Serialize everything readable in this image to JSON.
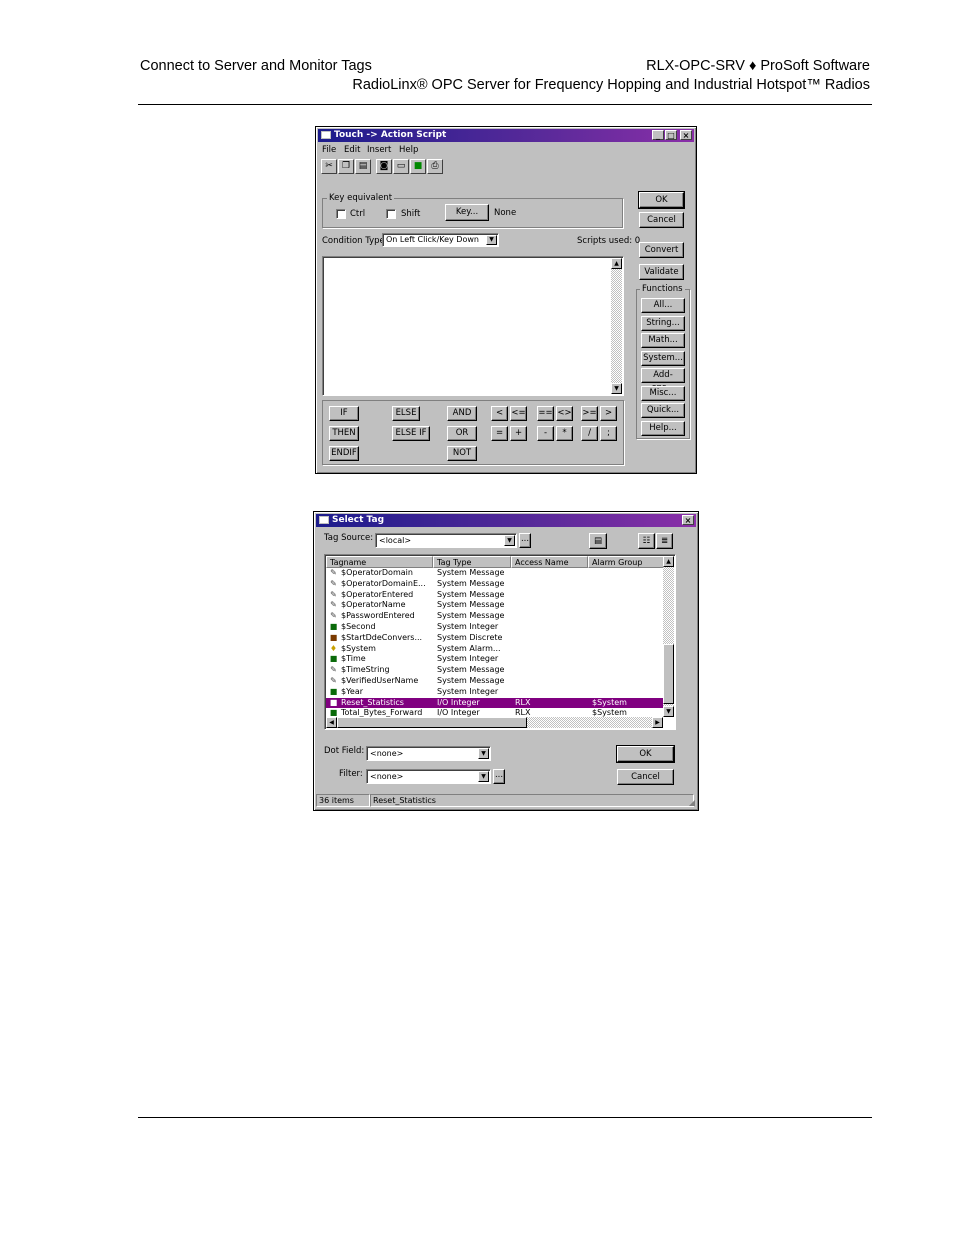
{
  "header": {
    "left": "Connect to Server and Monitor Tags",
    "right_line1": "RLX-OPC-SRV ♦ ProSoft Software",
    "right_line2": "RadioLinx® OPC Server for Frequency Hopping and Industrial Hotspot™ Radios"
  },
  "action_script": {
    "title": "Touch -> Action Script",
    "menu": [
      "File",
      "Edit",
      "Insert",
      "Help"
    ],
    "toolbar_icons": [
      "cut-icon",
      "copy-icon",
      "paste-icon",
      "find-icon",
      "window-icon",
      "import-icon",
      "print-icon"
    ],
    "key_group_label": "Key equivalent",
    "ctrl_label": "Ctrl",
    "shift_label": "Shift",
    "key_button": "Key...",
    "key_value": "None",
    "condition_label": "Condition Type:",
    "condition_value": "On Left Click/Key Down",
    "scripts_used": "Scripts used: 0",
    "ok": "OK",
    "cancel": "Cancel",
    "convert": "Convert",
    "validate": "Validate",
    "functions_label": "Functions",
    "functions": [
      "All...",
      "String...",
      "Math...",
      "System...",
      "Add-ons...",
      "Misc...",
      "Quick...",
      "Help..."
    ],
    "keywords": [
      "IF",
      "THEN",
      "ENDIF",
      "ELSE",
      "ELSE IF",
      "AND",
      "OR",
      "NOT"
    ],
    "operators": [
      "<",
      "<=",
      "==",
      "<>",
      ">=",
      ">",
      "=",
      "+",
      "-",
      "*",
      "/",
      ";"
    ]
  },
  "select_tag": {
    "title": "Select Tag",
    "tag_source_label": "Tag Source:",
    "tag_source_value": "<local>",
    "browse": "...",
    "columns": [
      "Tagname",
      "Tag Type",
      "Access Name",
      "Alarm Group"
    ],
    "rows": [
      {
        "name": "$OperatorDomain",
        "type": "System Message",
        "access": "",
        "group": "",
        "icon": "message-icon"
      },
      {
        "name": "$OperatorDomainE...",
        "type": "System Message",
        "access": "",
        "group": "",
        "icon": "message-icon"
      },
      {
        "name": "$OperatorEntered",
        "type": "System Message",
        "access": "",
        "group": "",
        "icon": "message-icon"
      },
      {
        "name": "$OperatorName",
        "type": "System Message",
        "access": "",
        "group": "",
        "icon": "message-icon"
      },
      {
        "name": "$PasswordEntered",
        "type": "System Message",
        "access": "",
        "group": "",
        "icon": "message-icon"
      },
      {
        "name": "$Second",
        "type": "System Integer",
        "access": "",
        "group": "",
        "icon": "integer-icon"
      },
      {
        "name": "$StartDdeConvers...",
        "type": "System Discrete",
        "access": "",
        "group": "",
        "icon": "discrete-icon"
      },
      {
        "name": "$System",
        "type": "System Alarm...",
        "access": "",
        "group": "",
        "icon": "alarm-icon"
      },
      {
        "name": "$Time",
        "type": "System Integer",
        "access": "",
        "group": "",
        "icon": "integer-icon"
      },
      {
        "name": "$TimeString",
        "type": "System Message",
        "access": "",
        "group": "",
        "icon": "message-icon"
      },
      {
        "name": "$VerifiedUserName",
        "type": "System Message",
        "access": "",
        "group": "",
        "icon": "message-icon"
      },
      {
        "name": "$Year",
        "type": "System Integer",
        "access": "",
        "group": "",
        "icon": "integer-icon"
      },
      {
        "name": "Reset_Statistics",
        "type": "I/O Integer",
        "access": "RLX",
        "group": "$System",
        "icon": "integer-icon",
        "selected": true
      },
      {
        "name": "Total_Bytes_Forward",
        "type": "I/O Integer",
        "access": "RLX",
        "group": "$System",
        "icon": "integer-icon"
      }
    ],
    "dot_field_label": "Dot Field:",
    "dot_field_value": "<none>",
    "filter_label": "Filter:",
    "filter_value": "<none>",
    "ok": "OK",
    "cancel": "Cancel",
    "status_count": "36 items",
    "status_selected": "Reset_Statistics"
  }
}
